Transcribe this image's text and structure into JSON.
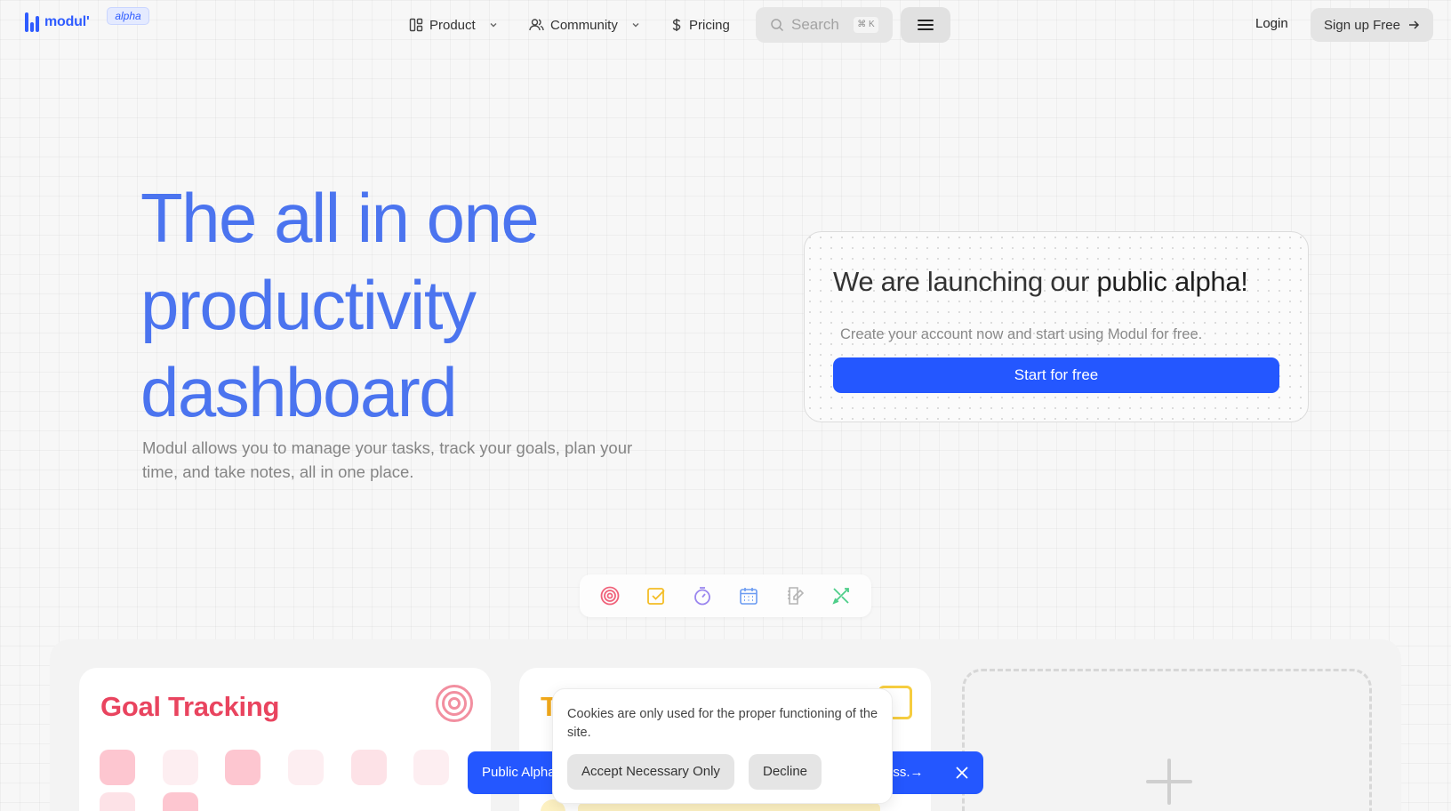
{
  "header": {
    "logo_text": "modul'",
    "badge": "alpha",
    "nav": {
      "product": "Product",
      "community": "Community",
      "pricing": "Pricing"
    },
    "search_placeholder": "Search",
    "search_shortcut": "⌘ K",
    "login": "Login",
    "signup": "Sign up Free"
  },
  "hero": {
    "title_line1": "The all in one",
    "title_line2": "productivity",
    "title_line3": "dashboard",
    "subtitle": "Modul allows you to manage your tasks, track your goals, plan your time, and take notes, all in one place."
  },
  "launch_card": {
    "title_lead": "We are launching our",
    "title_emph": "public alpha!",
    "subtitle": "Create your account now and start using Modul for free.",
    "button": "Start for free"
  },
  "feature_icons": [
    "target-icon",
    "checkbox-icon",
    "stopwatch-icon",
    "calendar-icon",
    "notebook-icon",
    "tools-icon"
  ],
  "cards": {
    "goal_title": "Goal Tracking",
    "tasks_title_visible": "T"
  },
  "banner": {
    "left_text": "Public Alpha",
    "right_text": "ess.→"
  },
  "cookie": {
    "message": "Cookies are only used for the proper functioning of the site.",
    "accept": "Accept Necessary Only",
    "decline": "Decline"
  },
  "colors": {
    "brand": "#2f5cff",
    "hero_title": "#4b74ef",
    "button_blue": "#2457ff",
    "goal_red": "#e9445f",
    "tasks_yellow": "#f2a91a"
  }
}
